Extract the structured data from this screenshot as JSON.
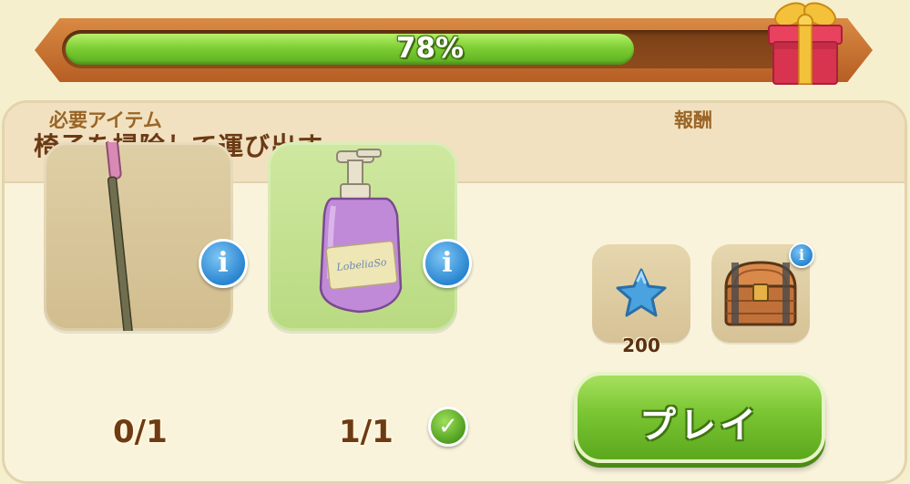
{
  "progress": {
    "percent": 78,
    "label": "78%",
    "icon": "gift-box-icon"
  },
  "quest": {
    "title": "椅子を掃除して運び出す"
  },
  "required_items": {
    "label": "必要アイテム",
    "items": [
      {
        "name": "broom",
        "icon": "broom-icon",
        "count": "0/1",
        "complete": false
      },
      {
        "name": "soap",
        "icon": "soap-bottle-icon",
        "count": "1/1",
        "complete": true,
        "bottle_label": "LobeliaSo"
      }
    ]
  },
  "rewards": {
    "label": "報酬",
    "items": [
      {
        "name": "stars",
        "icon": "blue-star-icon",
        "amount": "200"
      },
      {
        "name": "chest",
        "icon": "treasure-chest-icon"
      }
    ]
  },
  "play_button": {
    "label": "プレイ"
  },
  "colors": {
    "background": "#f6efcd",
    "progress_fill": "#7ecf35",
    "progress_frame": "#c46f2e",
    "title_text": "#6b3a14",
    "play_button": "#79c532",
    "info_button": "#2a85d0"
  }
}
